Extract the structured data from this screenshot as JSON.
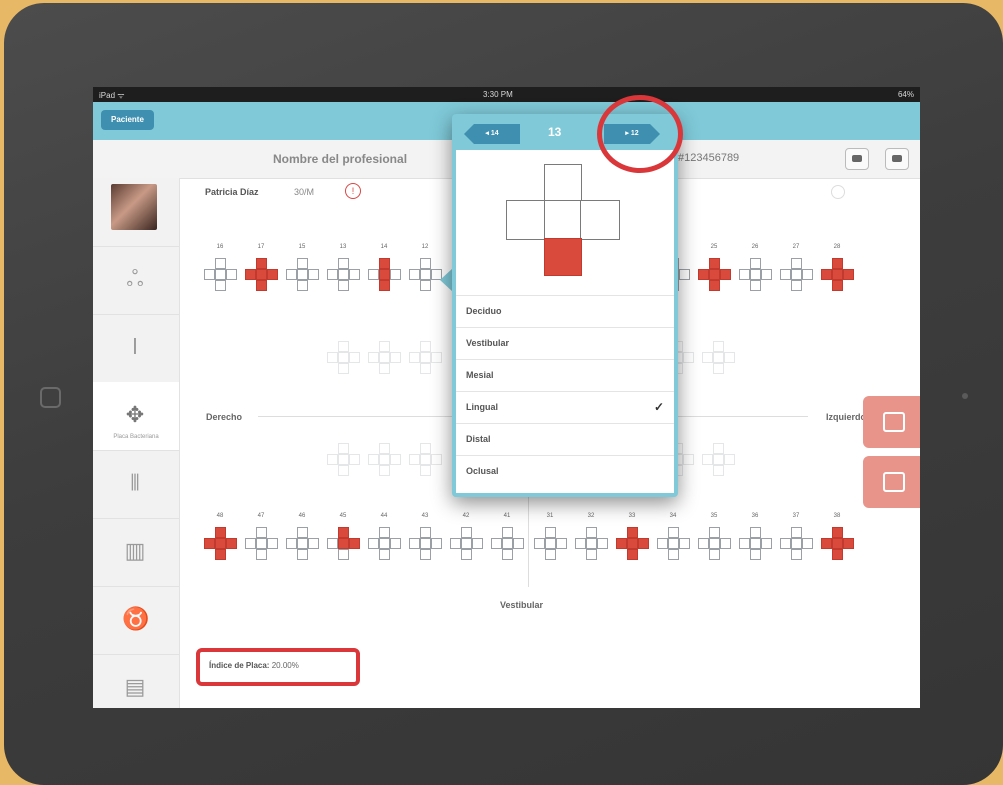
{
  "status_bar": {
    "carrier": "iPad ᯤ",
    "time": "3:30 PM",
    "battery": "64%"
  },
  "nav": {
    "back_label": "Paciente"
  },
  "header": {
    "professional_name": "Nombre del profesional",
    "record_number": "#123456789"
  },
  "patient": {
    "name": "Patricia Díaz",
    "age": "30/M",
    "alert_icon": "!"
  },
  "sidebar": {
    "items": [
      {
        "icon": "avatar"
      },
      {
        "icon": "odontogram-icon"
      },
      {
        "icon": "probe-icon"
      },
      {
        "icon": "plaque-icon",
        "label": "Placa Bacteriana",
        "active": true
      },
      {
        "icon": "instruments-icon"
      },
      {
        "icon": "trash-icon"
      },
      {
        "icon": "tooth-icon"
      },
      {
        "icon": "document-icon"
      }
    ]
  },
  "chart": {
    "upper_numbers": [
      "16",
      "17",
      "15",
      "13",
      "14",
      "12",
      "",
      "",
      "",
      "",
      "",
      "25",
      "26",
      "27",
      "28"
    ],
    "lower_numbers": [
      "48",
      "47",
      "46",
      "45",
      "44",
      "43",
      "42",
      "41",
      "31",
      "32",
      "33",
      "34",
      "35",
      "36",
      "37",
      "38"
    ],
    "labels": {
      "right": "Derecho",
      "left": "Izquierdo",
      "bottom": "Vestibular"
    }
  },
  "index": {
    "label": "Índice de Placa:",
    "value": "20.00%"
  },
  "popover": {
    "prev_label": "◂ 14",
    "title": "13",
    "next_label": "▸ 12",
    "options": [
      {
        "label": "Deciduo",
        "checked": false
      },
      {
        "label": "Vestibular",
        "checked": false
      },
      {
        "label": "Mesial",
        "checked": false
      },
      {
        "label": "Lingual",
        "checked": true
      },
      {
        "label": "Distal",
        "checked": false
      },
      {
        "label": "Oclusal",
        "checked": false
      }
    ],
    "check_mark": "✓"
  },
  "colors": {
    "accent": "#7fc9d8",
    "plaque": "#d94a3d",
    "highlight": "#d9373a"
  }
}
